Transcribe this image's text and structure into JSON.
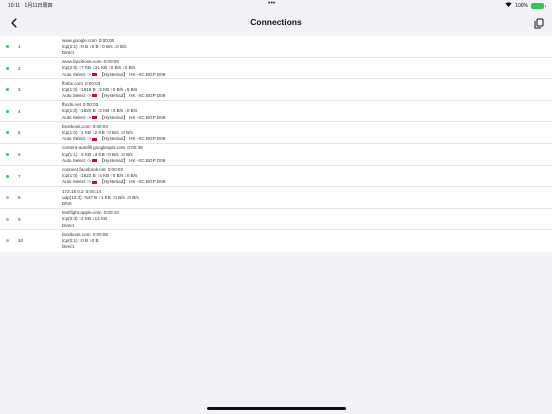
{
  "status": {
    "time": "10:11",
    "date": "1月11日周四",
    "battery": "100%"
  },
  "nav": {
    "title": "Connections"
  },
  "connections": [
    {
      "index": "1",
      "host": "www.google.com",
      "duration": "0:00:06",
      "traffic": "tcp(2:1) ↑0 B ↓0 B ↑0 B/s ↓0 B/s",
      "route": "Direct",
      "active": true,
      "flag": false
    },
    {
      "index": "2",
      "host": "www.facebook.com",
      "duration": "0:00:06",
      "traffic": "tcp(2:5) ↑7 KB ↓31 KB ↑0 B/s ↓0 B/s",
      "route": "Auto Select -> 【Hysteria2】 HK -XC BGP D09",
      "active": true,
      "flag": true
    },
    {
      "index": "3",
      "host": "fbsbx.com",
      "duration": "0:00:03",
      "traffic": "tcp(1:0) ↑1619 B ↓3 KB ↑0 B/s ↓8 B/s",
      "route": "Auto Select -> 【Hysteria2】 HK -XC BGP D09",
      "active": true,
      "flag": true
    },
    {
      "index": "4",
      "host": "fbcdn.net",
      "duration": "0:00:03",
      "traffic": "tcp(1:0) ↑1820 B ↓3 KB ↑0 B/s ↓0 B/s",
      "route": "Auto Select -> 【Hysteria2】 HK -XC BGP D09",
      "active": true,
      "flag": true
    },
    {
      "index": "5",
      "host": "facebook.com",
      "duration": "0:00:04",
      "traffic": "tcp(1:0) ↑1 KB ↓2 KB ↑0 B/s ↓0 B/s",
      "route": "Auto Select -> 【Hysteria2】 HK -XC BGP D09",
      "active": true,
      "flag": true
    },
    {
      "index": "6",
      "host": "content-autofill.googleapis.com",
      "duration": "0:00:39",
      "traffic": "tcp(1:1) ↑3 KB ↓3 KB ↑0 B/s ↓0 B/s",
      "route": "Auto Select -> 【Hysteria2】 HK -XC BGP D09",
      "active": true,
      "flag": true
    },
    {
      "index": "7",
      "host": "connect.facebook.net",
      "duration": "0:00:02",
      "traffic": "tcp(1:0) ↑1822 B ↓4 KB ↑0 B/s ↓0 B/s",
      "route": "Auto Select -> 【Hysteria2】 HK -XC BGP D09",
      "active": true,
      "flag": true
    },
    {
      "index": "8",
      "host": "172.19.0.2",
      "duration": "0:00:14",
      "traffic": "udp(12:4) ↑547 B ↓1 KB ↑0 B/s ↓0 B/s",
      "route": "DNS",
      "active": false,
      "flag": false
    },
    {
      "index": "9",
      "host": "testflight.apple.com",
      "duration": "0:00:10",
      "traffic": "tcp(0:3) ↑2 KB ↓12 KB",
      "route": "Direct",
      "active": false,
      "flag": false
    },
    {
      "index": "10",
      "host": "facebook.com",
      "duration": "0:00:05",
      "traffic": "tcp(0:1) ↑0 B ↓0 B",
      "route": "Direct",
      "active": false,
      "flag": false
    }
  ]
}
